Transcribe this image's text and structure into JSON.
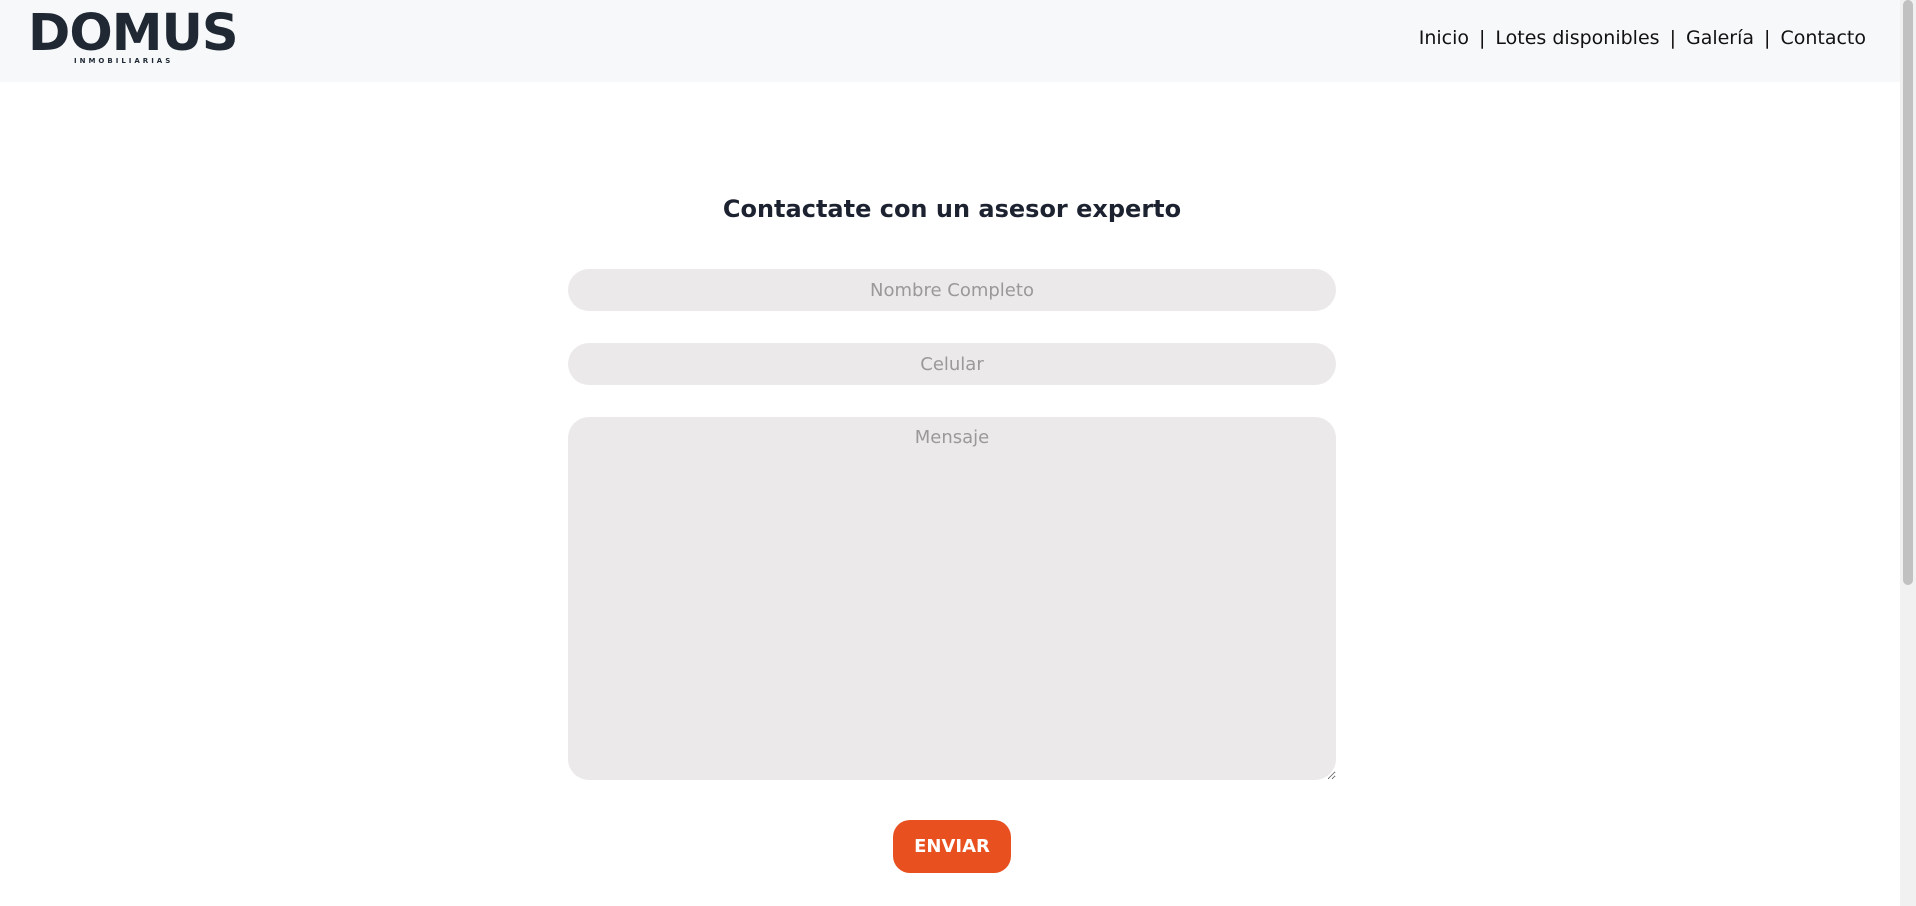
{
  "header": {
    "logo": {
      "name": "DOMUS",
      "tagline": "INMOBILIARIAS"
    },
    "nav": [
      {
        "label": "Inicio"
      },
      {
        "label": "Lotes disponibles"
      },
      {
        "label": "Galería"
      },
      {
        "label": "Contacto"
      }
    ],
    "separator": "|"
  },
  "contact_form": {
    "title": "Contactate con un asesor experto",
    "name_field": {
      "placeholder": "Nombre Completo",
      "value": ""
    },
    "phone_field": {
      "placeholder": "Celular",
      "value": ""
    },
    "message_field": {
      "placeholder": "Mensaje",
      "value": ""
    },
    "submit_label": "ENVIAR"
  },
  "colors": {
    "accent": "#e8501f",
    "header_bg": "#f7f8fa",
    "field_bg": "#ebe9ea",
    "logo": "#1f2833"
  }
}
